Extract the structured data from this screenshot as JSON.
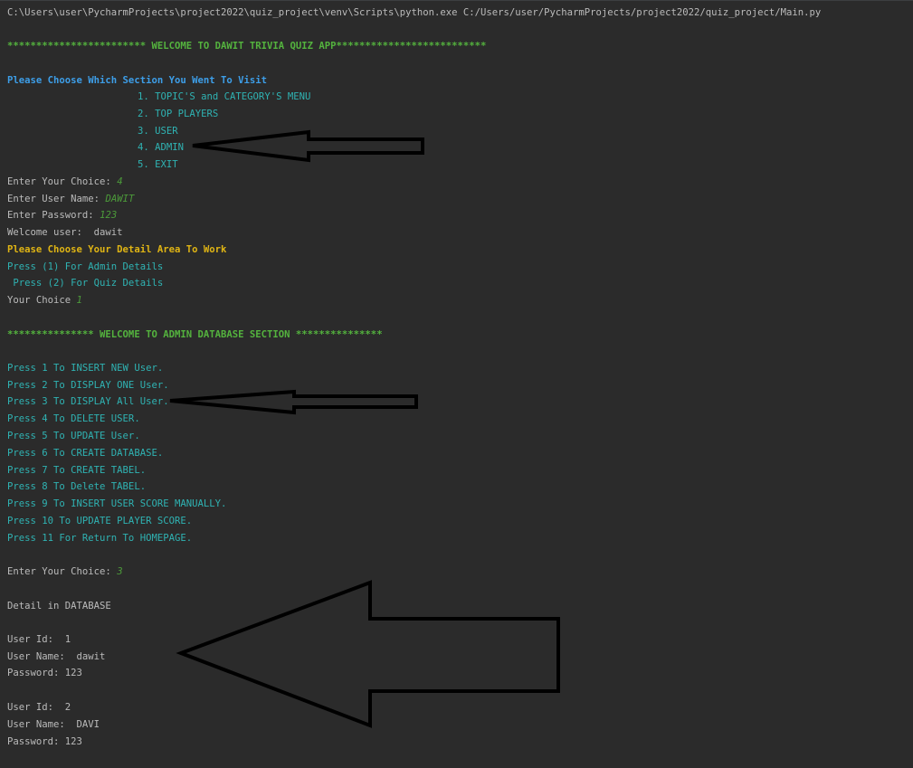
{
  "console": {
    "command": "C:\\Users\\user\\PycharmProjects\\project2022\\quiz_project\\venv\\Scripts\\python.exe C:/Users/user/PycharmProjects/project2022/quiz_project/Main.py",
    "welcome_banner": "************************ WELCOME TO DAWIT TRIVIA QUIZ APP**************************",
    "choose_section": "Please Choose Which Section You Went To Visit",
    "main_menu": [
      "1. TOPIC'S and CATEGORY'S MENU",
      "2. TOP PLAYERS",
      "3. USER",
      "4. ADMIN",
      "5. EXIT"
    ],
    "enter_choice_label": "Enter Your Choice: ",
    "enter_choice_value": "4",
    "enter_username_label": "Enter User Name: ",
    "enter_username_value": "DAWIT",
    "enter_password_label": "Enter Password: ",
    "enter_password_value": "123",
    "welcome_user": "Welcome user:  dawit",
    "detail_prompt": "Please Choose Your Detail Area To Work",
    "press_admin": "Press (1) For Admin Details",
    "press_quiz": " Press (2) For Quiz Details",
    "your_choice_label": "Your Choice ",
    "your_choice_value": "1",
    "admin_banner": "*************** WELCOME TO ADMIN DATABASE SECTION ***************",
    "admin_menu": [
      "Press 1 To INSERT NEW User.",
      "Press 2 To DISPLAY ONE User.",
      "Press 3 To DISPLAY All User.",
      "Press 4 To DELETE USER.",
      "Press 5 To UPDATE User.",
      "Press 6 To CREATE DATABASE.",
      "Press 7 To CREATE TABEL.",
      "Press 8 To Delete TABEL.",
      "Press 9 To INSERT USER SCORE MANUALLY.",
      "Press 10 To UPDATE PLAYER SCORE.",
      "Press 11 For Return To HOMEPAGE."
    ],
    "enter_choice2_label": "Enter Your Choice: ",
    "enter_choice2_value": "3",
    "detail_db": "Detail in DATABASE",
    "records": [
      {
        "id": "User Id:  1",
        "name": "User Name:  dawit",
        "password": "Password: 123"
      },
      {
        "id": "User Id:  2",
        "name": "User Name:  DAVI",
        "password": "Password: 123"
      }
    ]
  },
  "colors": {
    "background": "#2b2b2b",
    "default_text": "#bbbbbb",
    "banner_green": "#54b33e",
    "prompt_blue": "#3d9ee8",
    "menu_cyan": "#2fb3b3",
    "prompt_yellow": "#e0b514",
    "input_green": "#4c9a3a",
    "arrow": "#000000"
  }
}
